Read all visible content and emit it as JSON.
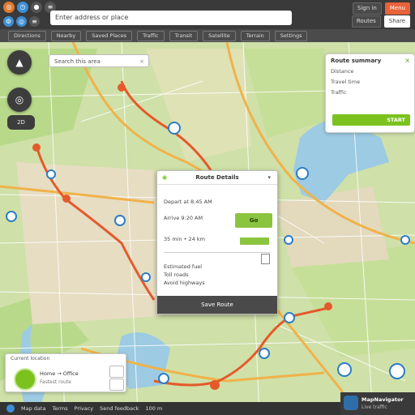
{
  "toolbar": {
    "search_text": "Enter address or place",
    "left_icons": [
      "compass-icon",
      "clock-icon",
      "pin-icon",
      "layers-icon"
    ],
    "buttons": [
      "Sign in",
      "Menu"
    ],
    "buttons2": [
      "Routes",
      "Share"
    ]
  },
  "nav": {
    "items": [
      "Directions",
      "Nearby",
      "Saved Places",
      "Traffic",
      "Transit",
      "Satellite",
      "Terrain",
      "Settings"
    ]
  },
  "left_controls": {
    "top": "▲",
    "middle": "◎",
    "small": "2D"
  },
  "map_search": {
    "text": "Search this area",
    "clear": "×"
  },
  "info_card": {
    "title": "Route summary",
    "lines": [
      "Distance",
      "Travel time",
      "Traffic"
    ],
    "go_label": "START"
  },
  "popup": {
    "header": "Route Details",
    "rows": [
      "Depart at 8:45 AM",
      "Arrive 9:20 AM",
      "35 min • 24 km",
      "Estimated fuel",
      "Toll roads",
      "Avoid highways"
    ],
    "go_label": "Go",
    "footer": "Save Route"
  },
  "route_card": {
    "head": "Current location",
    "label": "Home → Office",
    "sub": "Fastest route"
  },
  "statusbar": {
    "items": [
      "Map data",
      "Terms",
      "Privacy",
      "Send feedback",
      "100 m"
    ]
  },
  "legend": {
    "title": "MapNavigator",
    "sub": "Live traffic"
  },
  "colors": {
    "land": "#cfe0a8",
    "water": "#9ccbe3",
    "major_road": "#f0b24a",
    "route": "#e45a2b",
    "accent_green": "#7cc21f",
    "toolbar": "#3a3a3a"
  }
}
